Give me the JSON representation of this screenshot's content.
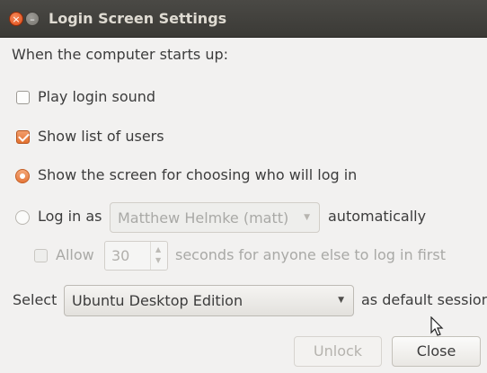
{
  "window": {
    "title": "Login Screen Settings",
    "close_glyph": "×",
    "minimize_glyph": "–"
  },
  "intro": "When the computer starts up:",
  "options": {
    "play_login_sound": {
      "label": "Play login sound",
      "checked": false
    },
    "show_list_of_users": {
      "label": "Show list of users",
      "checked": true
    },
    "show_chooser": {
      "label": "Show the screen for choosing who will log in",
      "selected": true
    },
    "log_in_as": {
      "label": "Log in as",
      "user": "Matthew Helmke (matt)",
      "suffix": "automatically",
      "selected": false
    },
    "allow": {
      "label": "Allow",
      "seconds": "30",
      "suffix": "seconds for anyone else to log in first",
      "checked": false
    }
  },
  "session": {
    "label": "Select",
    "value": "Ubuntu Desktop Edition",
    "suffix": "as default session"
  },
  "buttons": {
    "unlock": "Unlock",
    "close": "Close"
  },
  "colors": {
    "accent": "#e4712f",
    "titlebar": "#3c3b37",
    "background": "#f2f1f0"
  },
  "icons": {
    "combo_arrow": "chevron-down-icon",
    "cursor": "mouse-pointer-icon"
  }
}
